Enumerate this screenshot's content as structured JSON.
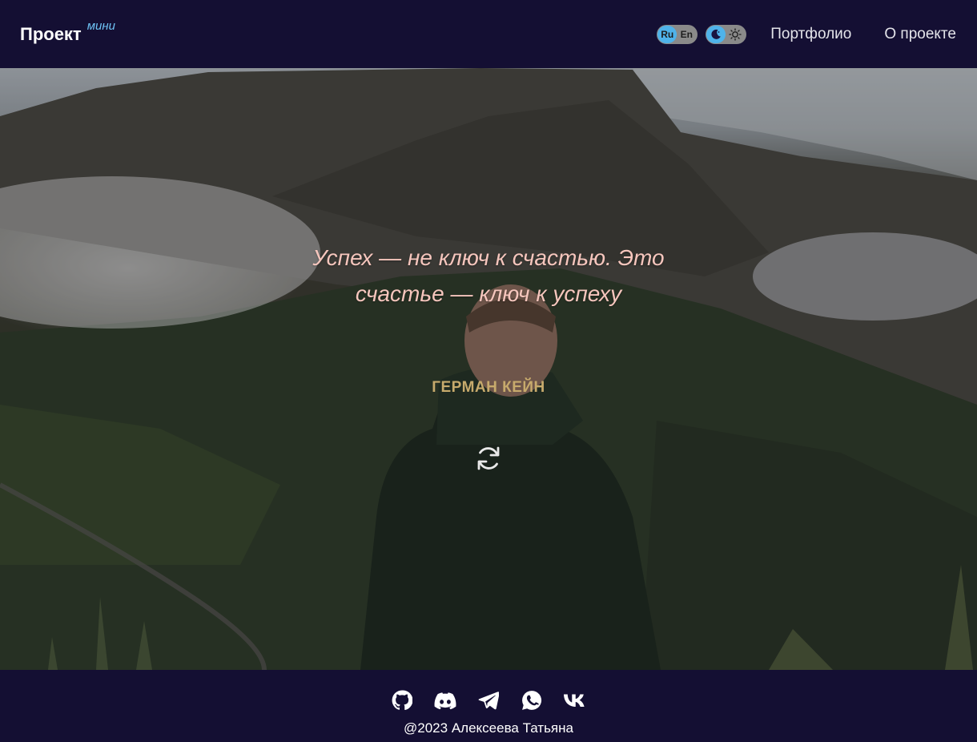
{
  "header": {
    "logo_main": "Проект",
    "logo_sup": "мини",
    "lang_ru": "Ru",
    "lang_en": "En",
    "lang_active": "Ru",
    "theme_active": "dark",
    "theme_dark_icon": "moon-icon",
    "theme_light_icon": "sun-icon",
    "nav": [
      {
        "label": "Портфолио"
      },
      {
        "label": "О проекте"
      }
    ]
  },
  "hero": {
    "background": "mountain-landscape-photo",
    "quote": "Успех — не ключ к счастью. Это счастье — ключ к успеху",
    "author": "ГЕРМАН КЕЙН",
    "refresh_icon": "refresh-icon"
  },
  "footer": {
    "socials": [
      {
        "icon": "github-icon"
      },
      {
        "icon": "discord-icon"
      },
      {
        "icon": "telegram-icon"
      },
      {
        "icon": "whatsapp-icon"
      },
      {
        "icon": "vk-icon"
      }
    ],
    "copyright": "@2023 Алексеева Татьяна"
  },
  "colors": {
    "bar_bg": "#140f33",
    "accent": "#4fb3ea",
    "quote": "#f6c6bd",
    "author": "#c7aa6c"
  }
}
